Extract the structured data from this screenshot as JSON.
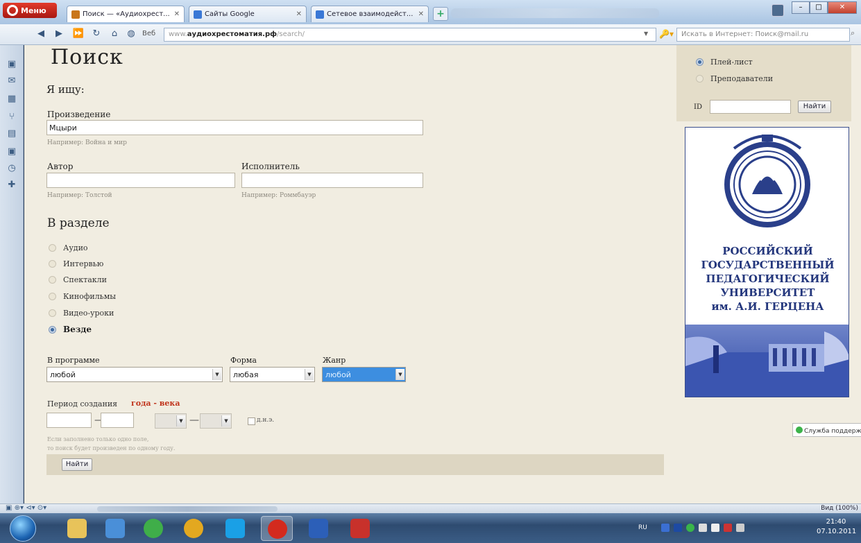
{
  "browser": {
    "menu_label": "Меню",
    "tabs": [
      {
        "label": "Поиск — «Аудиохрест...",
        "color": "#c9761b",
        "active": true
      },
      {
        "label": "Сайты Google",
        "color": "#3a78d6",
        "active": false
      },
      {
        "label": "Сетевое взаимодейст...",
        "color": "#3a78d6",
        "active": false
      }
    ],
    "new_tab": "+",
    "web_badge": "Веб",
    "address_prefix": "www.",
    "address_domain": "аудиохрестоматия.рф",
    "address_path": "/search/",
    "search_placeholder": "Искать в Интернет: Поиск@mail.ru",
    "window_controls": [
      "–",
      "□",
      "✕"
    ]
  },
  "sidebar_icons": [
    "bookmark-icon",
    "mail-icon",
    "panel-icon",
    "share-icon",
    "notes-icon",
    "download-icon",
    "history-icon",
    "add-icon"
  ],
  "page": {
    "title": "Поиск",
    "looking_for": "Я ищу:",
    "work_label": "Произведение",
    "work_value": "Мцыри",
    "work_hint": "Например: Война и мир",
    "author_label": "Автор",
    "author_value": "",
    "author_hint": "Например: Толстой",
    "performer_label": "Исполнитель",
    "performer_value": "",
    "performer_hint": "Например: Роммбауэр",
    "section_title": "В разделе",
    "sections": [
      {
        "label": "Аудио",
        "checked": false
      },
      {
        "label": "Интервью",
        "checked": false
      },
      {
        "label": "Спектакли",
        "checked": false
      },
      {
        "label": "Кинофильмы",
        "checked": false
      },
      {
        "label": "Видео-уроки",
        "checked": false
      },
      {
        "label": "Везде",
        "checked": true
      }
    ],
    "program_label": "В программе",
    "program_value": "любой",
    "form_label": "Форма",
    "form_value": "любая",
    "genre_label": "Жанр",
    "genre_value": "любой",
    "period_label": "Период создания",
    "period_mode": "года - века",
    "dash": "—",
    "bc_label": "д.н.э.",
    "note_line1": "Если заполнено только одно поле,",
    "note_line2": "то поиск будет произведен по одному году.",
    "submit": "Найти"
  },
  "right": {
    "options": [
      {
        "label": "Плей-лист",
        "checked": true
      },
      {
        "label": "Преподаватели",
        "checked": false
      }
    ],
    "id_label": "ID",
    "id_value": "",
    "find_button": "Найти",
    "university_line1": "РОССИЙСКИЙ",
    "university_line2": "ГОСУДАРСТВЕННЫЙ",
    "university_line3": "ПЕДАГОГИЧЕСКИЙ",
    "university_line4": "УНИВЕРСИТЕТ",
    "university_line5": "им. А.И. ГЕРЦЕНА",
    "support_label": "Служба поддерж"
  },
  "statusbar": {
    "zoom": "Вид (100%)"
  },
  "taskbar": {
    "apps": [
      {
        "name": "explorer-icon",
        "color": "#e8c35a"
      },
      {
        "name": "media-player-icon",
        "color": "#4a8fd8"
      },
      {
        "name": "mail-agent-icon",
        "color": "#3fae49"
      },
      {
        "name": "chrome-icon",
        "color": "#e3a820"
      },
      {
        "name": "skype-icon",
        "color": "#1aa0e6"
      },
      {
        "name": "opera-icon",
        "color": "#d32a1e"
      },
      {
        "name": "word-icon",
        "color": "#2c5fb8"
      },
      {
        "name": "paint-icon",
        "color": "#c8312b"
      }
    ],
    "lang": "RU",
    "time": "21:40",
    "date": "07.10.2011"
  }
}
